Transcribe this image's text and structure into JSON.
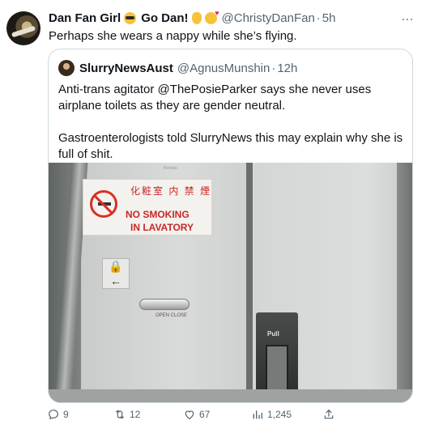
{
  "tweet": {
    "author_name": "Dan Fan Girl",
    "badge_text": "Go Dan!",
    "handle": "@ChristyDanFan",
    "separator": "·",
    "time": "5h",
    "text": "Perhaps she wears a nappy while she’s flying.",
    "more_icon": "…"
  },
  "quote": {
    "author_name": "SlurryNewsAust",
    "handle": "@AgnusMunshin",
    "separator": "·",
    "time": "12h",
    "paragraph1": "Anti-trans agitator @ThePosieParker says she never uses airplane toilets as they are gender neutral.",
    "paragraph2": "Gastroenterologists told SlurryNews this may explain why she is full of shit."
  },
  "photo": {
    "sign_cn": "化粧室 内 禁 煙",
    "sign_en_line1": "NO SMOKING",
    "sign_en_line2": "IN LAVATORY",
    "lock_glyph": "🔒",
    "open_label": "OPEN CLOSE",
    "pull_label": "Pull",
    "kmdb": "Kinodai"
  },
  "actions": {
    "replies": "9",
    "retweets": "12",
    "likes": "67",
    "views": "1,245"
  },
  "colors": {
    "text_primary": "#0f1419",
    "text_secondary": "#536471",
    "border": "#cfd9de",
    "sign_red": "#c62828"
  },
  "icons": [
    "more-icon",
    "reply-icon",
    "retweet-icon",
    "like-icon",
    "views-icon",
    "share-icon"
  ]
}
